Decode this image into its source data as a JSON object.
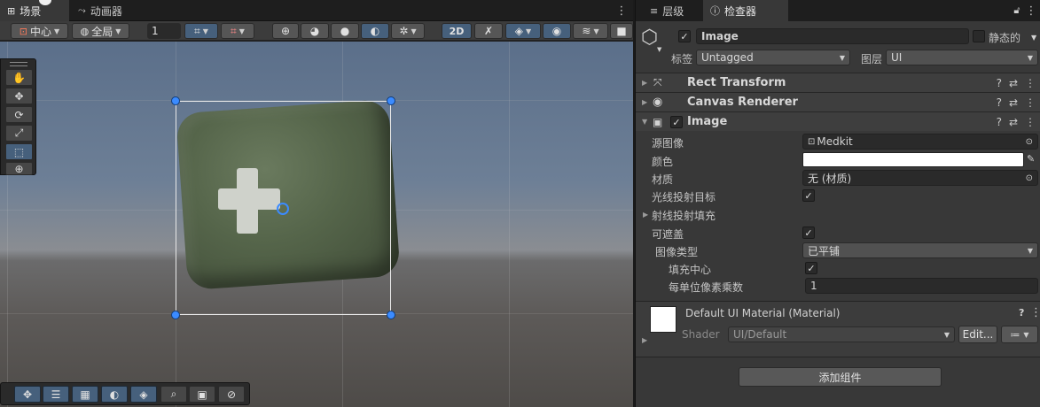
{
  "scene": {
    "tabs": [
      {
        "label": "场景",
        "icon": "grid-icon"
      },
      {
        "label": "动画器",
        "icon": "animator-icon"
      }
    ],
    "toolbar": {
      "pivot_label": "中心",
      "space_label": "全局",
      "increment_value": "1",
      "mode_2d_label": "2D"
    },
    "tools": [
      "hand-tool",
      "move-tool",
      "rotate-tool",
      "scale-tool",
      "rect-tool",
      "transform-tool"
    ],
    "object": {
      "name": "Medkit",
      "cross_color": "#cfd2cb",
      "body_color": "#55654a"
    },
    "overlay_tools": [
      "move-overlay",
      "settings-overlay",
      "grid-overlay",
      "shading-overlay",
      "layers-overlay",
      "search-overlay",
      "camera-overlay",
      "gizmo-overlay"
    ]
  },
  "inspector": {
    "tabs": [
      {
        "label": "层级",
        "icon": "list-icon"
      },
      {
        "label": "检查器",
        "icon": "info-icon"
      }
    ],
    "object": {
      "name": "Image",
      "active": true,
      "static_label": "静态的",
      "tag_label": "标签",
      "tag_value": "Untagged",
      "layer_label": "图层",
      "layer_value": "UI"
    },
    "components": {
      "rect_transform": "Rect Transform",
      "canvas_renderer": "Canvas Renderer",
      "image": "Image"
    },
    "image_props": {
      "source_label": "源图像",
      "source_value": "Medkit",
      "color_label": "颜色",
      "color_value": "#ffffff",
      "material_label": "材质",
      "material_value": "无 (材质)",
      "raycast_target_label": "光线投射目标",
      "raycast_target": true,
      "raycast_padding_label": "射线投射填充",
      "maskable_label": "可遮盖",
      "maskable": true,
      "image_type_label": "图像类型",
      "image_type_value": "已平铺",
      "fill_center_label": "填充中心",
      "fill_center": true,
      "ppu_label": "每单位像素乘数",
      "ppu_value": "1"
    },
    "material": {
      "title": "Default UI Material (Material)",
      "shader_label": "Shader",
      "shader_value": "UI/Default",
      "edit_label": "Edit..."
    },
    "add_component_label": "添加组件"
  },
  "colors": {
    "accent": "#3b8bff",
    "selected_tool": "#46607c"
  }
}
